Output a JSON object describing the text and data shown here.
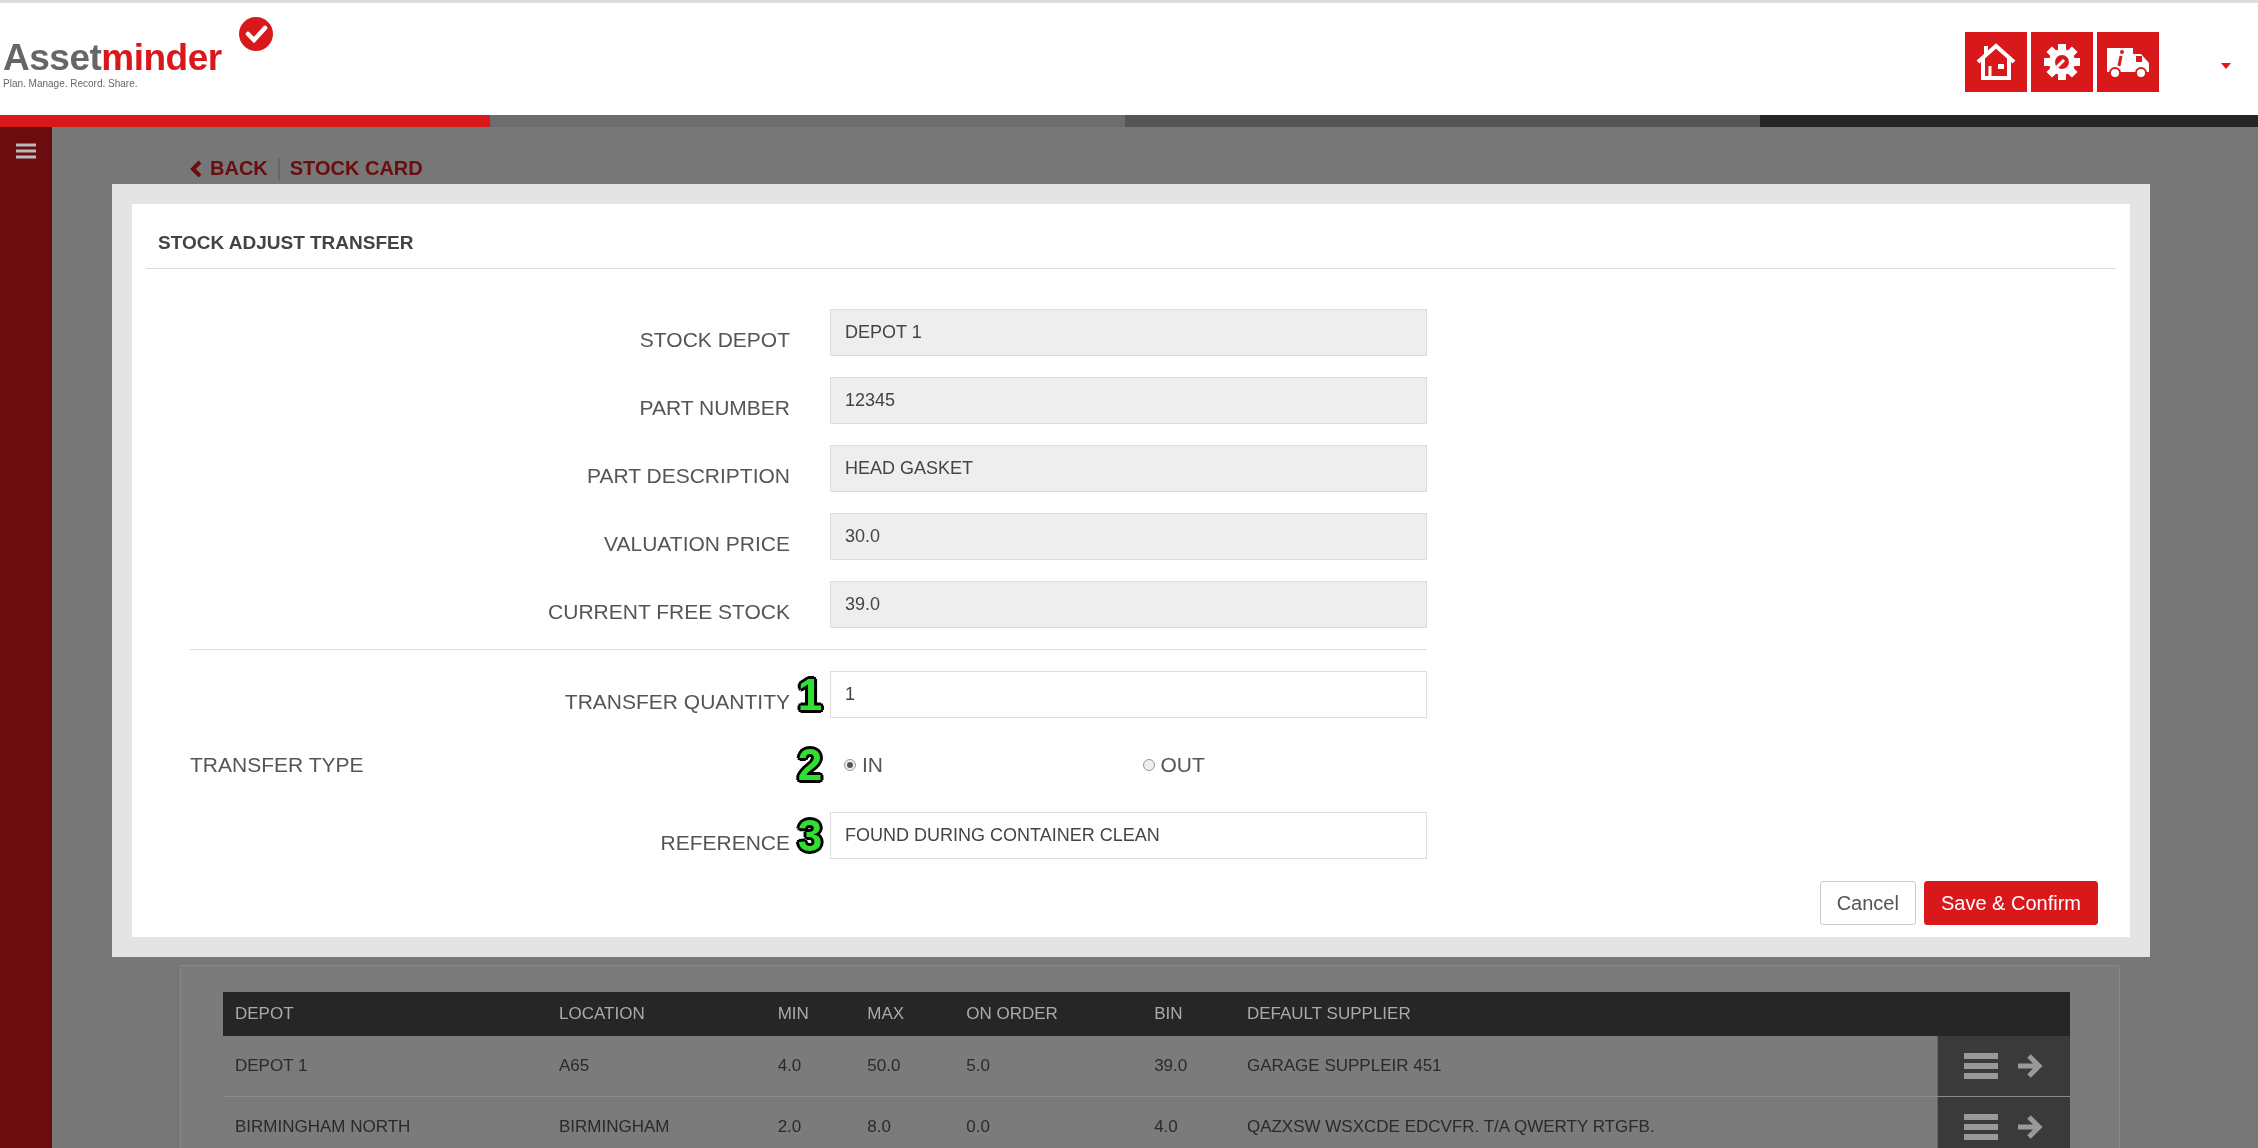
{
  "header": {
    "logo": {
      "part1": "Asset",
      "part2": "minder",
      "tagline": "Plan. Manage. Record. Share."
    }
  },
  "breadcrumb": {
    "back": "BACK",
    "current": "STOCK CARD"
  },
  "modal": {
    "title": "STOCK ADJUST TRANSFER",
    "fields": [
      {
        "kind": "readonly",
        "label": "STOCK DEPOT",
        "value": "DEPOT 1"
      },
      {
        "kind": "readonly",
        "label": "PART NUMBER",
        "value": "12345"
      },
      {
        "kind": "readonly",
        "label": "PART DESCRIPTION",
        "value": "HEAD GASKET"
      },
      {
        "kind": "readonly",
        "label": "VALUATION PRICE",
        "value": "30.0"
      },
      {
        "kind": "readonly",
        "label": "CURRENT FREE STOCK",
        "value": "39.0"
      },
      {
        "kind": "input",
        "label": "TRANSFER QUANTITY",
        "value": "1",
        "marker": "1"
      },
      {
        "kind": "radio",
        "label": "TRANSFER TYPE",
        "marker": "2",
        "options": [
          {
            "label": "IN",
            "selected": true
          },
          {
            "label": "OUT",
            "selected": false
          }
        ]
      },
      {
        "kind": "input",
        "label": "REFERENCE",
        "value": "FOUND DURING CONTAINER CLEAN",
        "marker": "3"
      }
    ],
    "buttons": [
      {
        "label": "Cancel",
        "kind": "secondary"
      },
      {
        "label": "Save & Confirm",
        "kind": "primary"
      }
    ]
  },
  "table": {
    "columns": [
      "DEPOT",
      "LOCATION",
      "MIN",
      "MAX",
      "ON ORDER",
      "BIN",
      "DEFAULT SUPPLIER"
    ],
    "rows": [
      {
        "cells": [
          "DEPOT 1",
          "A65",
          "4.0",
          "50.0",
          "5.0",
          "39.0",
          "GARAGE SUPPLEIR 451"
        ]
      },
      {
        "cells": [
          "BIRMINGHAM NORTH",
          "BIRMINGHAM",
          "2.0",
          "8.0",
          "0.0",
          "4.0",
          "QAZXSW WSXCDE EDCVFR. T/A QWERTY RTGFB."
        ]
      }
    ]
  }
}
